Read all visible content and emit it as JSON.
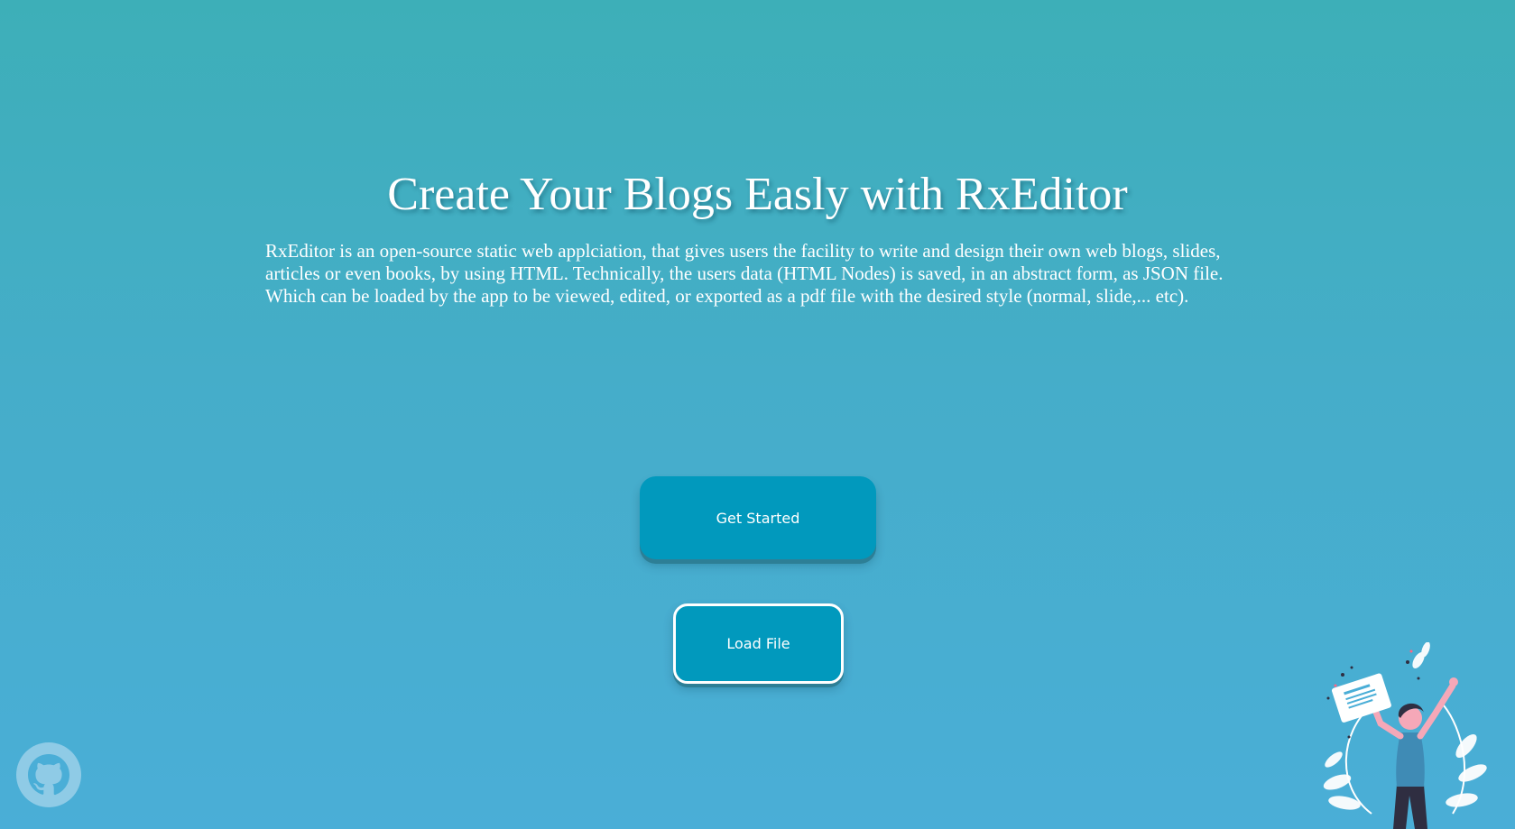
{
  "hero": {
    "title": "Create Your Blogs Easly with RxEditor",
    "description": "RxEditor is an open-source static web applciation, that gives users the facility to write and design their own web blogs, slides, articles or even books, by using HTML. Technically, the users data (HTML Nodes) is saved, in an abstract form, as JSON file. Which can be loaded by the app to be viewed, edited, or exported as a pdf file with the desired style (normal, slide,... etc)."
  },
  "actions": {
    "get_started_label": "Get Started",
    "load_file_label": "Load File"
  },
  "icons": {
    "github": "github-icon",
    "illustration": "woman-holding-document-illustration"
  },
  "colors": {
    "background_top": "#3dafb8",
    "background_bottom": "#4aaed7",
    "button": "#0199bd",
    "button_shadow": "#2d7f96",
    "text": "#ffffff"
  }
}
